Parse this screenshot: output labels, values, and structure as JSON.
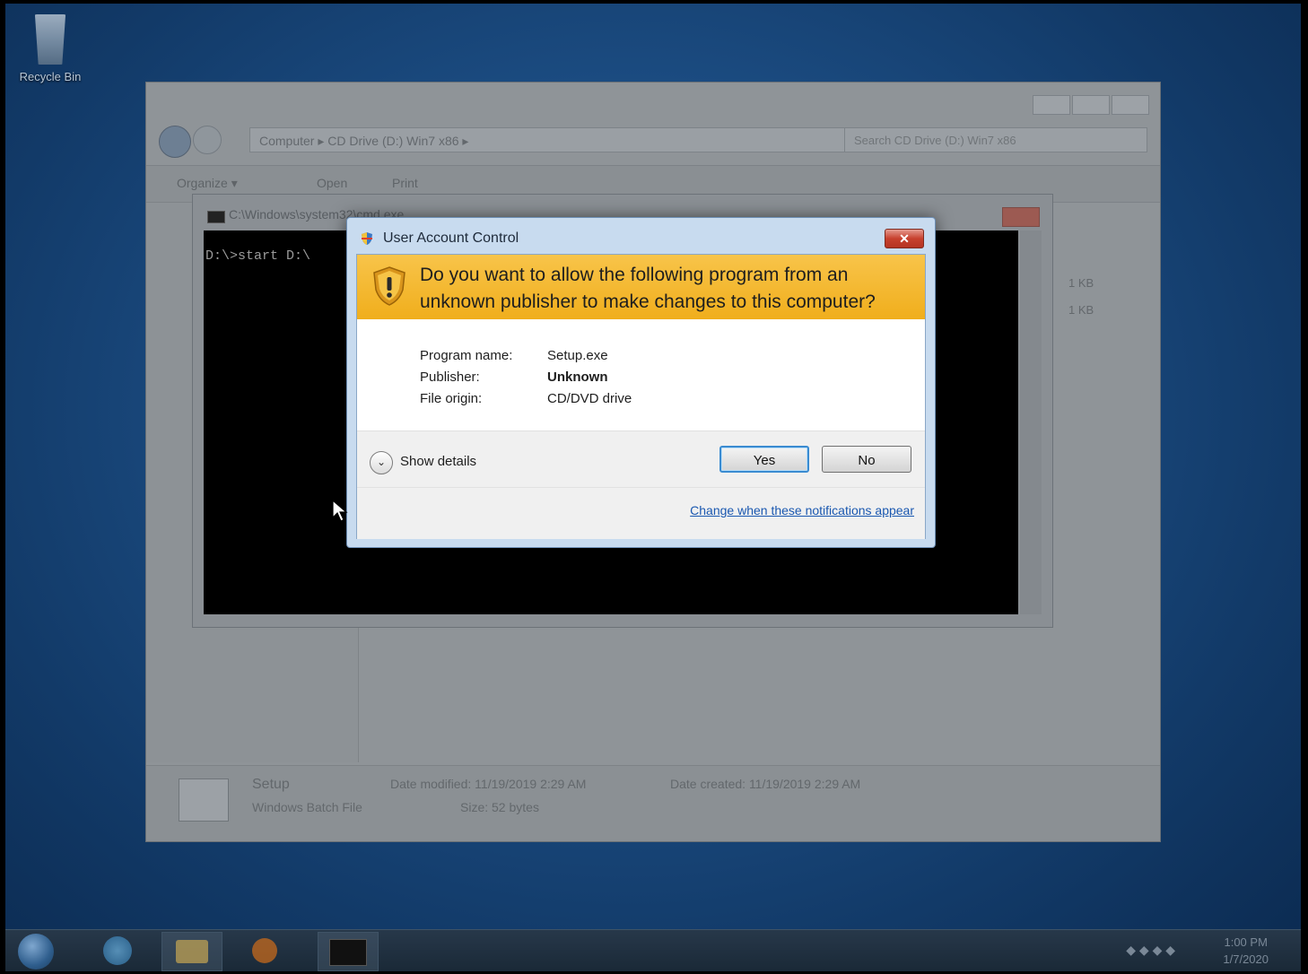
{
  "desktop": {
    "recycle_bin_label": "Recycle Bin"
  },
  "explorer": {
    "breadcrumb": "Computer  ▸  CD Drive (D:) Win7 x86  ▸",
    "search_placeholder": "Search CD Drive (D:) Win7 x86",
    "toolbar": {
      "organize": "Organize ▾",
      "open": "Open",
      "print": "Print"
    },
    "sizes": [
      "1 KB",
      "1 KB"
    ],
    "details": {
      "name": "Setup",
      "type": "Windows Batch File",
      "date_modified": "Date modified: 11/19/2019 2:29 AM",
      "size": "Size: 52 bytes",
      "date_created": "Date created: 11/19/2019 2:29 AM"
    }
  },
  "console": {
    "title": "C:\\Windows\\system32\\cmd.exe",
    "prompt_text": "D:\\>start D:\\"
  },
  "uac": {
    "title": "User Account Control",
    "question": "Do you want to allow the following program from an unknown publisher to make changes to this computer?",
    "fields": {
      "program_name_label": "Program name:",
      "program_name_value": "Setup.exe",
      "publisher_label": "Publisher:",
      "publisher_value": "Unknown",
      "file_origin_label": "File origin:",
      "file_origin_value": "CD/DVD drive"
    },
    "show_details": "Show details",
    "yes": "Yes",
    "no": "No",
    "link": "Change when these notifications appear",
    "colors": {
      "banner": "#f0ae1c",
      "link": "#1a58b0",
      "close": "#c7412e"
    }
  },
  "taskbar": {
    "clock_time": "1:00 PM",
    "clock_date": "1/7/2020"
  }
}
